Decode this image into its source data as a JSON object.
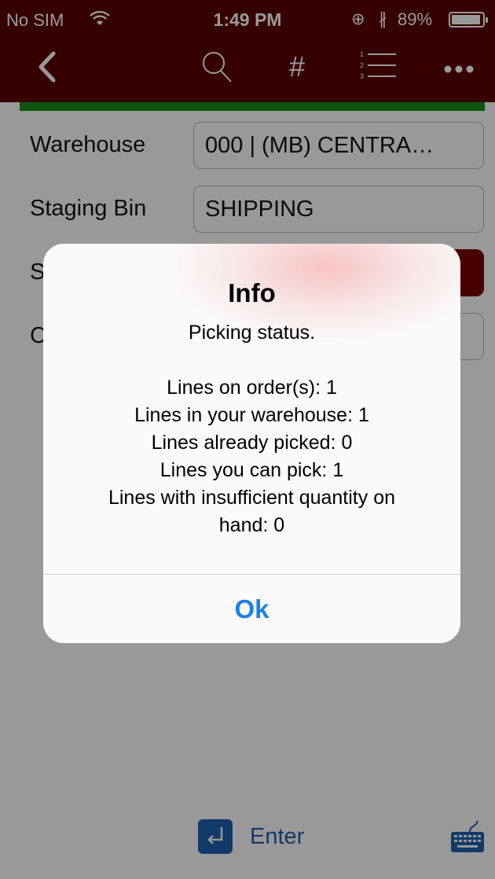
{
  "status_bar": {
    "carrier": "No SIM",
    "time": "1:49 PM",
    "battery_percent": "89%",
    "battery_level": 0.89
  },
  "nav": {
    "icons": [
      "back-icon",
      "search-icon",
      "hash-icon",
      "numbered-list-icon",
      "more-icon"
    ],
    "hash_symbol": "#"
  },
  "form": {
    "warehouse_label": "Warehouse",
    "warehouse_value": "000 | (MB) CENTRA…",
    "staging_bin_label": "Staging Bin",
    "staging_bin_value": "SHIPPING",
    "row3_label_partial": "S",
    "row4_label_partial": "C"
  },
  "bottom_bar": {
    "enter_label": "Enter"
  },
  "alert": {
    "title": "Info",
    "lines": [
      "Picking status.",
      "",
      "Lines on order(s): 1",
      "Lines in your warehouse: 1",
      "Lines already picked: 0",
      "Lines you can pick: 1",
      "Lines with insufficient quantity on",
      "hand: 0"
    ],
    "ok_label": "Ok"
  },
  "colors": {
    "header_bg": "#5a0000",
    "accent_green": "#1a8c1a",
    "link_blue": "#1a7fe8",
    "enter_blue": "#1f5fb0"
  }
}
